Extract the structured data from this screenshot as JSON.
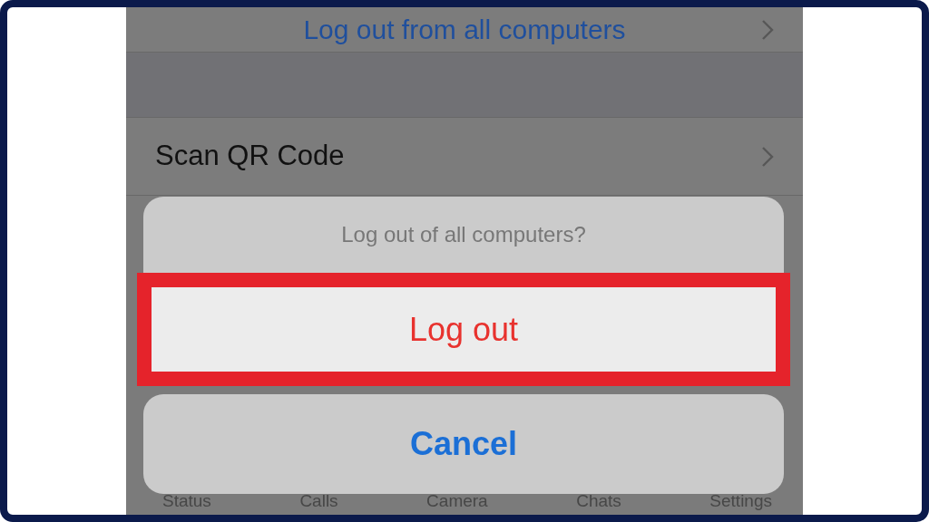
{
  "settings_list": [
    {
      "kind": "link",
      "label": "Log out from all computers"
    },
    {
      "kind": "spacer"
    },
    {
      "kind": "item",
      "label": "Scan QR Code"
    }
  ],
  "action_sheet": {
    "title": "Log out of all computers?",
    "actions": [
      {
        "label": "Log out",
        "kind": "destructive",
        "highlighted": true
      }
    ],
    "cancel": {
      "label": "Cancel"
    }
  },
  "tab_bar": [
    {
      "label": "Status"
    },
    {
      "label": "Calls"
    },
    {
      "label": "Camera"
    },
    {
      "label": "Chats"
    },
    {
      "label": "Settings"
    }
  ]
}
